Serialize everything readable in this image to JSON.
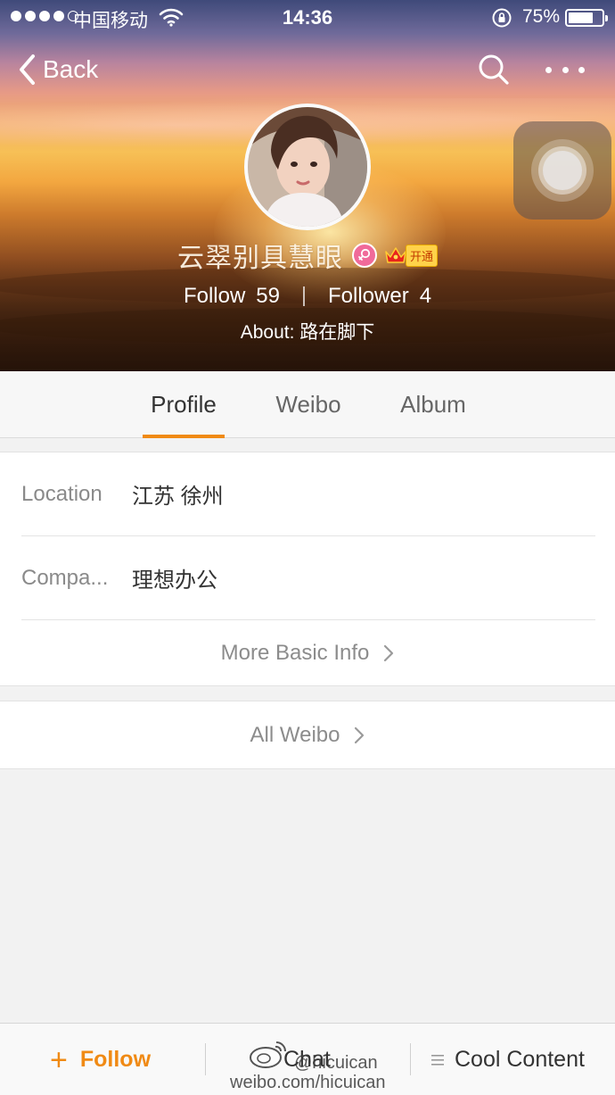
{
  "status_bar": {
    "carrier": "中国移动",
    "time": "14:36",
    "battery_percent": "75%",
    "battery_level": 0.75
  },
  "nav": {
    "back_label": "Back"
  },
  "profile": {
    "name": "云翠别具慧眼",
    "vip_label": "开通",
    "follow_label": "Follow",
    "follow_count": "59",
    "follower_label": "Follower",
    "follower_count": "4",
    "about": "About: 路在脚下"
  },
  "tabs": [
    {
      "label": "Profile",
      "active": true
    },
    {
      "label": "Weibo",
      "active": false
    },
    {
      "label": "Album",
      "active": false
    }
  ],
  "basic_info": {
    "rows": [
      {
        "label": "Location",
        "value": "江苏 徐州"
      },
      {
        "label": "Compa...",
        "value": "理想办公"
      }
    ],
    "more_label": "More Basic Info"
  },
  "all_weibo_label": "All Weibo",
  "toolbar": {
    "follow_label": "Follow",
    "chat_label": "Chat",
    "cool_content_label": "Cool Content"
  },
  "watermark": {
    "handle": "@hicuican",
    "url": "weibo.com/hicuican"
  },
  "colors": {
    "accent": "#f08a14",
    "female_badge": "#f06a9a"
  }
}
